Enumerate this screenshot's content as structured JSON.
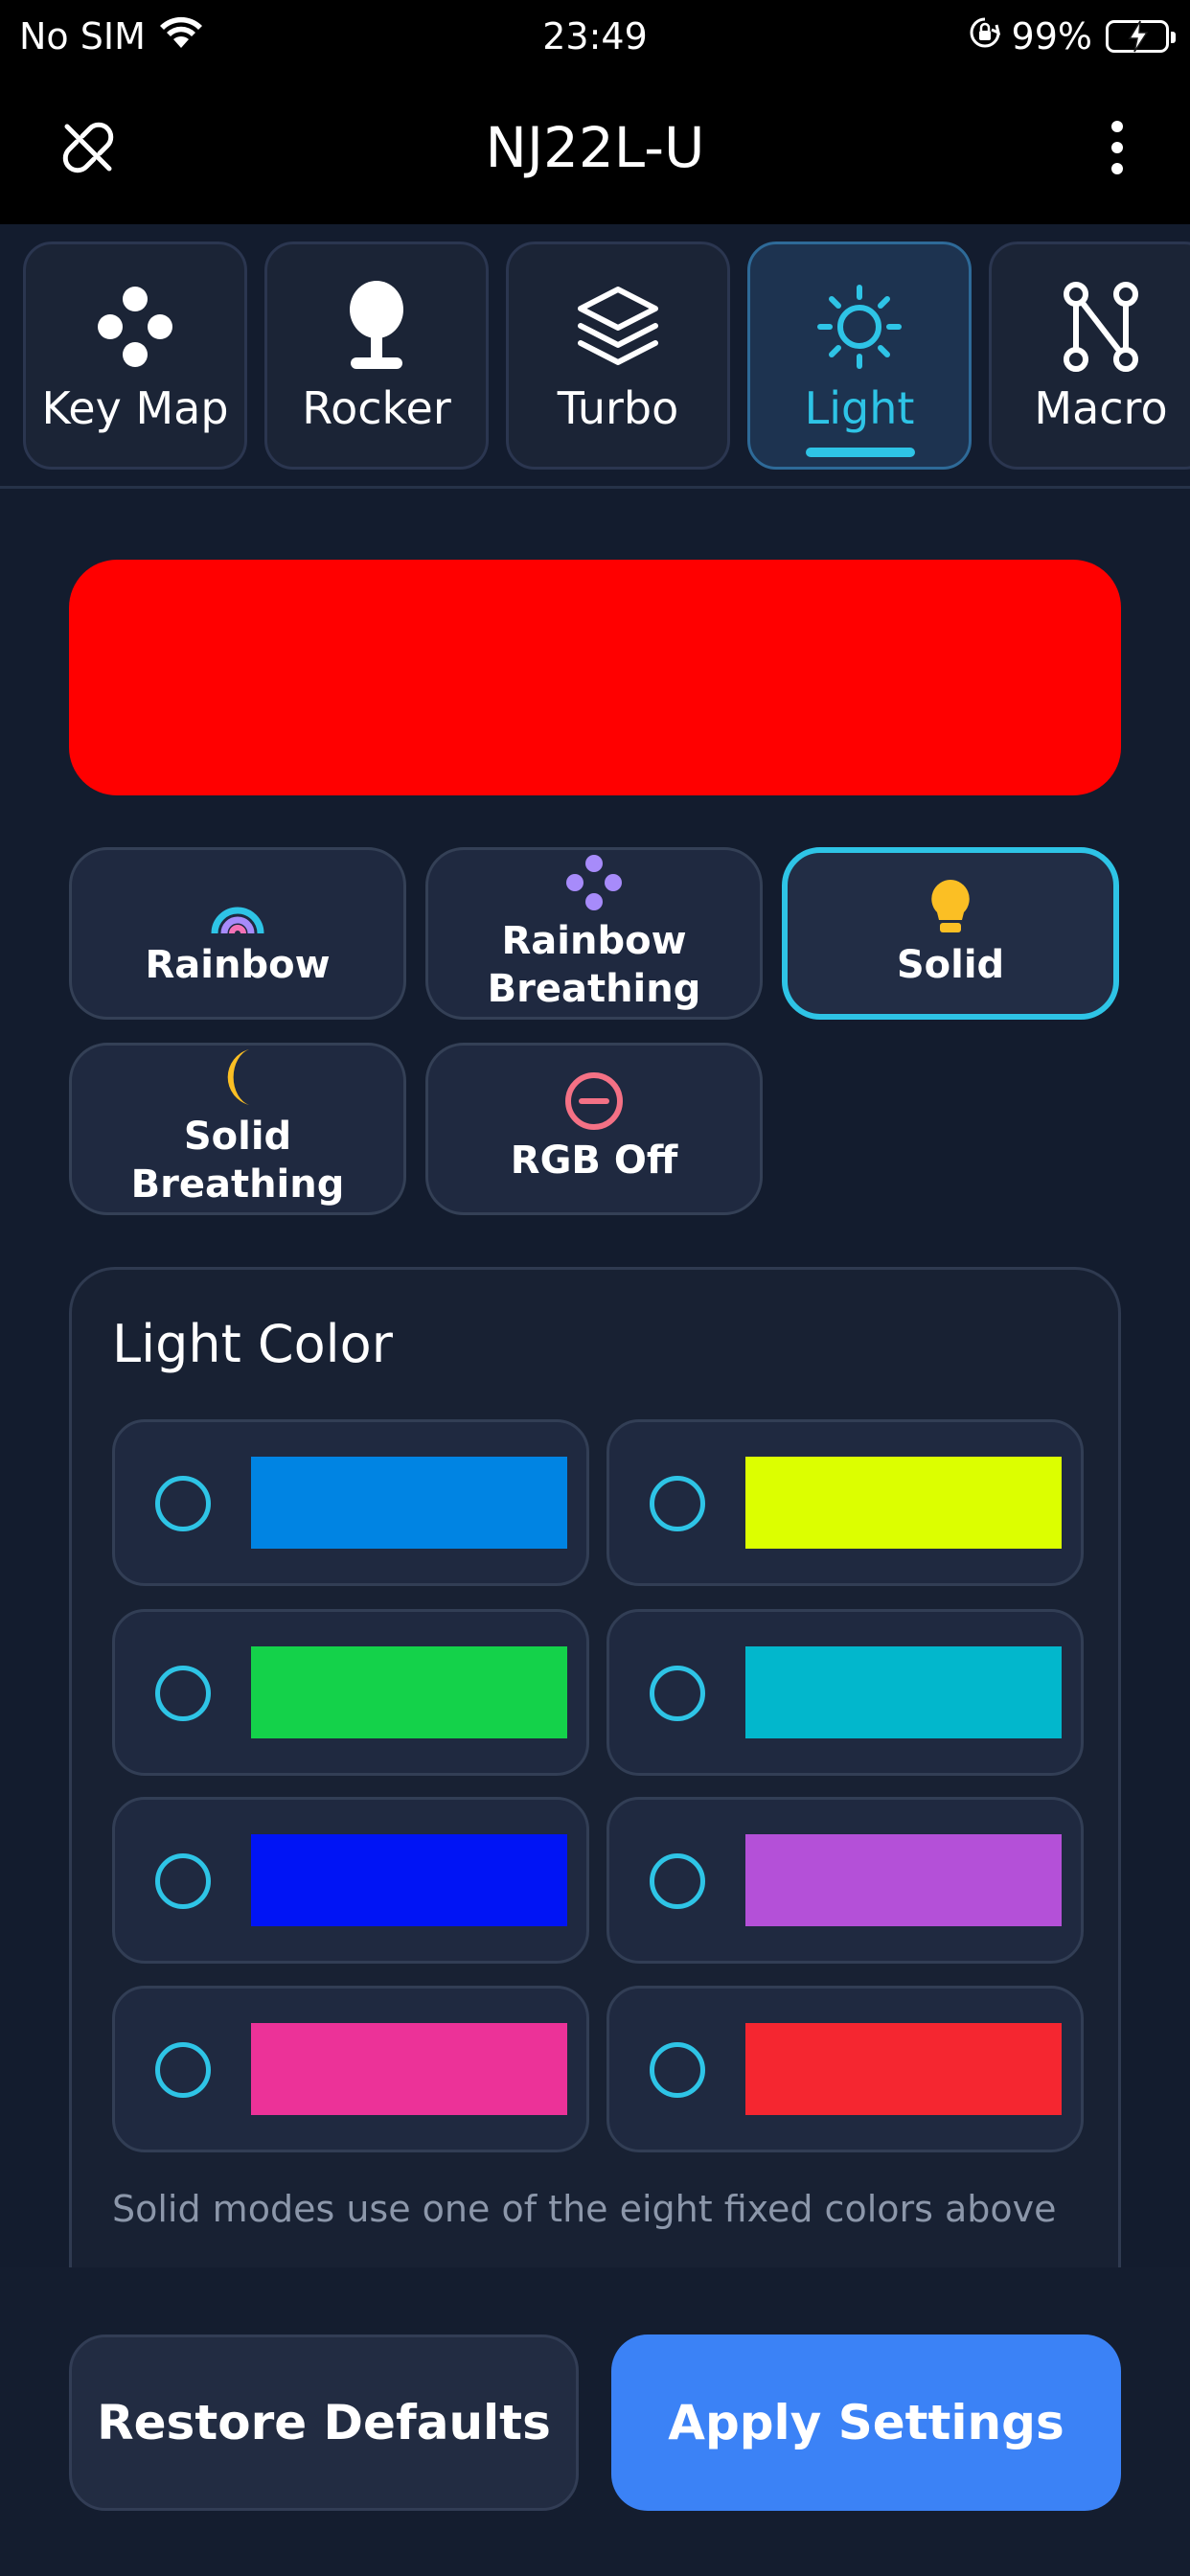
{
  "status_bar": {
    "carrier": "No SIM",
    "time": "23:49",
    "battery": "99%"
  },
  "header": {
    "title": "NJ22L-U"
  },
  "tabs": [
    {
      "label": "Key Map",
      "icon": "gamepad-buttons-icon"
    },
    {
      "label": "Rocker",
      "icon": "joystick-icon"
    },
    {
      "label": "Turbo",
      "icon": "layers-icon"
    },
    {
      "label": "Light",
      "icon": "sun-icon",
      "active": true
    },
    {
      "label": "Macro",
      "icon": "macro-node-icon"
    }
  ],
  "preview": {
    "color": "#ff0000"
  },
  "modes": [
    {
      "label": "Rainbow",
      "icon": "rainbow-icon"
    },
    {
      "label": "Rainbow\nBreathing",
      "icon": "dots-icon"
    },
    {
      "label": "Solid",
      "icon": "bulb-icon",
      "selected": true
    },
    {
      "label": "Solid Breathing",
      "icon": "moon-icon"
    },
    {
      "label": "RGB Off",
      "icon": "off-icon"
    }
  ],
  "light_color": {
    "title": "Light Color",
    "swatches": [
      "#0084e3",
      "#dcff00",
      "#14d24a",
      "#02b7cc",
      "#0014f5",
      "#b450d8",
      "#ec3298",
      "#f52630"
    ],
    "hint": "Solid modes use one of the eight fixed colors above"
  },
  "footer": {
    "restore_label": "Restore Defaults",
    "apply_label": "Apply Settings"
  },
  "colors": {
    "accent": "#2ec4e6",
    "apply": "#3b82f6",
    "background": "#131c2e"
  }
}
